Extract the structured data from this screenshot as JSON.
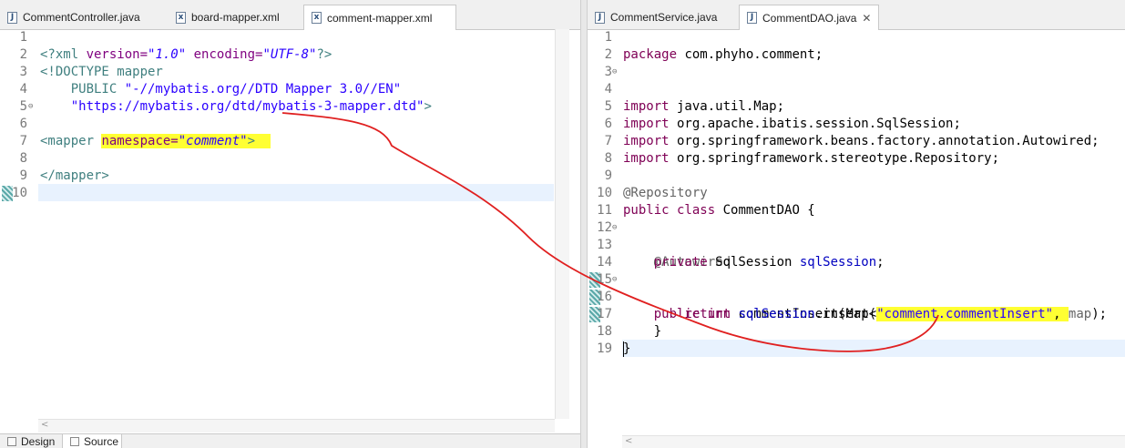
{
  "left_tabs": [
    {
      "label": "CommentController.java",
      "icon": "J",
      "active": false
    },
    {
      "label": "board-mapper.xml",
      "icon": "x",
      "active": false
    },
    {
      "label": "comment-mapper.xml",
      "icon": "x",
      "active": true
    }
  ],
  "right_tabs": [
    {
      "label": "CommentService.java",
      "icon": "J",
      "active": false
    },
    {
      "label": "CommentDAO.java",
      "icon": "J",
      "active": true,
      "close": "✕"
    }
  ],
  "left_editor": {
    "line_numbers": [
      "1",
      "2",
      "3",
      "4",
      "5",
      "6",
      "7",
      "8",
      "9",
      "10"
    ],
    "lines": {
      "l1_open": "<?xml ",
      "l1_a1": "version=",
      "l1_v1": "\"1.0\"",
      "l1_a2": " encoding=",
      "l1_v2": "\"UTF-8\"",
      "l1_close": "?>",
      "l2": "<!DOCTYPE mapper",
      "l3_indent": "    PUBLIC ",
      "l3_str": "\"-//mybatis.org//DTD Mapper 3.0//EN\"",
      "l4_str": "    \"https://mybatis.org/dtd/mybatis-3-mapper.dtd\"",
      "l4_close": ">",
      "l5_open": "<mapper ",
      "l5_attr": "namespace=",
      "l5_val": "\"comment\"",
      "l5_close": ">",
      "l8": "</mapper>"
    }
  },
  "right_editor": {
    "line_numbers": [
      "1",
      "2",
      "3",
      "4",
      "5",
      "6",
      "7",
      "8",
      "9",
      "10",
      "11",
      "12",
      "13",
      "14",
      "15",
      "16",
      "17",
      "18",
      "19"
    ],
    "lines": {
      "l1_kw": "package",
      "l1_rest": " com.phyho.comment;",
      "l3_kw": "import",
      "l3_rest": " java.util.Map;",
      "l5_kw": "import",
      "l5_rest": " org.apache.ibatis.session.SqlSession;",
      "l6_kw": "import",
      "l6_rest": " org.springframework.beans.factory.annotation.Autowired;",
      "l7_kw": "import",
      "l7_rest": " org.springframework.stereotype.Repository;",
      "l9": "@Repository",
      "l10_kw": "public class",
      "l10_rest": " CommentDAO {",
      "l12": "    @Autowired",
      "l13_kw": "    private",
      "l13_type": " SqlSession ",
      "l13_field": "sqlSession",
      "l13_end": ";",
      "l15_kw": "    public int",
      "l15_rest": " commentInsert(Map<String, Object> ",
      "l15_param": "map",
      "l15_end": ") {",
      "l16_kw": "        return",
      "l16_sp": " ",
      "l16_field": "sqlSession",
      "l16_mid": ".insert(",
      "l16_str": "\"comment.commentInsert\"",
      "l16_comma": ", ",
      "l16_param": "map",
      "l16_end": ");",
      "l17": "    }",
      "l18": "}"
    }
  },
  "bottom_tabs": [
    {
      "label": "Design",
      "active": false
    },
    {
      "label": "Source",
      "active": true
    }
  ],
  "colors": {
    "highlight": "#ffff33",
    "annotation_curve": "#e02020"
  }
}
